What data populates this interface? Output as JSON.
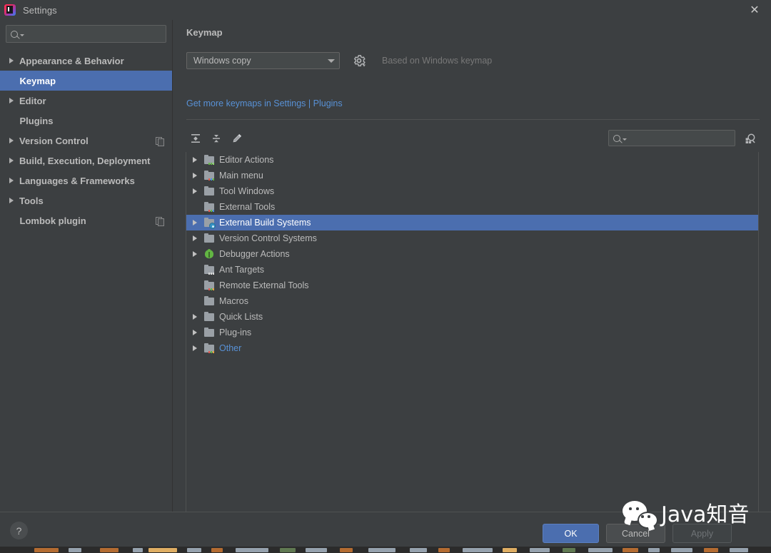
{
  "window": {
    "title": "Settings",
    "app_icon": "intellij-idea-icon",
    "close_icon": "close-icon"
  },
  "sidebar": {
    "search": {
      "placeholder": "",
      "value": "",
      "icon": "search-icon"
    },
    "items": [
      {
        "label": "Appearance & Behavior",
        "expandable": true,
        "selected": false,
        "badge": false
      },
      {
        "label": "Keymap",
        "expandable": false,
        "selected": true,
        "badge": false
      },
      {
        "label": "Editor",
        "expandable": true,
        "selected": false,
        "badge": false
      },
      {
        "label": "Plugins",
        "expandable": false,
        "selected": false,
        "badge": false
      },
      {
        "label": "Version Control",
        "expandable": true,
        "selected": false,
        "badge": true
      },
      {
        "label": "Build, Execution, Deployment",
        "expandable": true,
        "selected": false,
        "badge": false
      },
      {
        "label": "Languages & Frameworks",
        "expandable": true,
        "selected": false,
        "badge": false
      },
      {
        "label": "Tools",
        "expandable": true,
        "selected": false,
        "badge": false
      },
      {
        "label": "Lombok plugin",
        "expandable": false,
        "selected": false,
        "badge": true
      }
    ]
  },
  "main": {
    "panel_title": "Keymap",
    "keymap_combo": {
      "value": "Windows copy",
      "options": [
        "Windows copy"
      ],
      "caret_icon": "chevron-down-icon"
    },
    "gear_icon": "gear-icon",
    "based_on_text": "Based on Windows keymap",
    "link_text": "Get more keymaps in Settings | Plugins",
    "toolbar": {
      "expand_all_label": "Expand All",
      "collapse_all_label": "Collapse All",
      "edit_shortcut_label": "Edit Shortcut",
      "expand_all_icon": "expand-all-icon",
      "collapse_all_icon": "collapse-all-icon",
      "edit_icon": "pencil-icon",
      "search_placeholder": "",
      "search_value": "",
      "search_icon": "search-icon",
      "find_action_icon": "find-by-shortcut-icon"
    },
    "tree": [
      {
        "label": "Editor Actions",
        "expandable": true,
        "icon": "folder-editor-icon",
        "selected": false,
        "link": false
      },
      {
        "label": "Main menu",
        "expandable": true,
        "icon": "folder-menu-icon",
        "selected": false,
        "link": false
      },
      {
        "label": "Tool Windows",
        "expandable": true,
        "icon": "folder-icon",
        "selected": false,
        "link": false
      },
      {
        "label": "External Tools",
        "expandable": false,
        "icon": "folder-tools-icon",
        "selected": false,
        "link": false
      },
      {
        "label": "External Build Systems",
        "expandable": true,
        "icon": "folder-build-icon",
        "selected": true,
        "link": false
      },
      {
        "label": "Version Control Systems",
        "expandable": true,
        "icon": "folder-icon",
        "selected": false,
        "link": false
      },
      {
        "label": "Debugger Actions",
        "expandable": true,
        "icon": "bug-icon",
        "selected": false,
        "link": false
      },
      {
        "label": "Ant Targets",
        "expandable": false,
        "icon": "folder-ant-icon",
        "selected": false,
        "link": false
      },
      {
        "label": "Remote External Tools",
        "expandable": false,
        "icon": "folder-remote-icon",
        "selected": false,
        "link": false
      },
      {
        "label": "Macros",
        "expandable": false,
        "icon": "folder-icon",
        "selected": false,
        "link": false
      },
      {
        "label": "Quick Lists",
        "expandable": true,
        "icon": "folder-icon",
        "selected": false,
        "link": false
      },
      {
        "label": "Plug-ins",
        "expandable": true,
        "icon": "folder-icon",
        "selected": false,
        "link": false
      },
      {
        "label": "Other",
        "expandable": true,
        "icon": "folder-other-icon",
        "selected": false,
        "link": true
      }
    ]
  },
  "footer": {
    "help_label": "?",
    "ok_label": "OK",
    "cancel_label": "Cancel",
    "apply_label": "Apply"
  },
  "watermark": {
    "text": "Java知音",
    "icon": "wechat-icon"
  },
  "colors": {
    "window_bg": "#3c3f41",
    "selection_blue": "#4b6eaf",
    "link_blue": "#5891d6",
    "text": "#bbbbbb",
    "muted_text": "#787878",
    "field_bg": "#45494a",
    "border": "#4f5152"
  }
}
